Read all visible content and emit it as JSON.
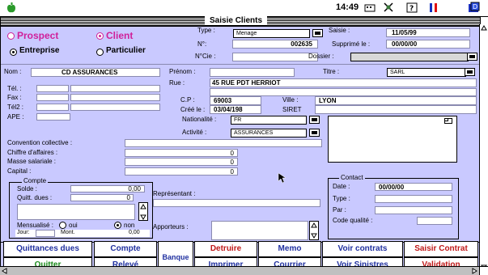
{
  "menubar": {
    "clock": "14:49"
  },
  "window": {
    "title": "Saisie Clients"
  },
  "type_radio": {
    "prospect": "Prospect",
    "client": "Client",
    "selected": "Client"
  },
  "nature_radio": {
    "entreprise": "Entreprise",
    "particulier": "Particulier",
    "selected": "Entreprise"
  },
  "header": {
    "type_label": "Type :",
    "type_value": "Menage",
    "no_label": "N°:",
    "no_value": "002635",
    "ncie_label": "N°Cie :",
    "ncie_value": "",
    "saisie_label": "Saisie :",
    "saisie_value": "11/05/99",
    "supprime_label": "Supprimé le :",
    "supprime_value": "00/00/00",
    "dossier_label": "Dossier :",
    "dossier_value": ""
  },
  "identity": {
    "nom_label": "Nom :",
    "nom_value": "CD ASSURANCES",
    "prenom_label": "Prénom :",
    "prenom_value": "",
    "titre_label": "Titre :",
    "titre_value": "SARL",
    "rue_label": "Rue :",
    "rue_value": "45 RUE PDT HERRIOT",
    "cp_label": "C.P :",
    "cp_value": "69003",
    "ville_label": "Ville :",
    "ville_value": "LYON",
    "cree_label": "Créé le :",
    "cree_value": "03/04/198",
    "siret_label": "SIRET",
    "tel_label": "Tél. :",
    "fax_label": "Fax :",
    "tel2_label": "Tél2 :",
    "ape_label": "APE :",
    "nationalite_label": "Nationalité :",
    "nationalite_value": "FR",
    "activite_label": "Activité :",
    "activite_value": "ASSURANCES"
  },
  "finance": {
    "convention_label": "Convention collective :",
    "ca_label": "Chiffre d'affaires :",
    "ca_value": "0",
    "masse_label": "Masse salariale :",
    "masse_value": "0",
    "capital_label": "Capital :",
    "capital_value": "0"
  },
  "compte": {
    "group_label": "Compte",
    "solde_label": "Solde :",
    "solde_value": "0,00",
    "quitt_label": "Quitt. dues :",
    "quitt_value": "0",
    "mensualise_label": "Mensualisé :",
    "oui_label": "oui",
    "non_label": "non",
    "mensualise_selected": "non",
    "jour_label": "Jour:",
    "mont_label": "Mont.",
    "mont_value": "0,00"
  },
  "representant_label": "Représentant :",
  "apporteurs_label": "Apporteurs :",
  "contact": {
    "group_label": "Contact",
    "date_label": "Date :",
    "date_value": "00/00/00",
    "type_label": "Type :",
    "par_label": "Par :",
    "qualite_label": "Code qualité :"
  },
  "buttons": {
    "quittances_dues": "Quittances dues",
    "compte": "Compte",
    "banque": "Banque",
    "detruire": "Detruire",
    "memo": "Memo",
    "voir_contrats": "Voir contrats",
    "saisir_contrat": "Saisir Contrat",
    "quitter": "Quitter",
    "releve": "Relevé",
    "imprimer": "Imprimer",
    "courrier": "Courrier",
    "voir_sinistres": "Voir Sinistres",
    "validation": "Validation"
  },
  "colors": {
    "form_bg": "#c9c9ff",
    "pink": "#d0209a",
    "blue_btn": "#2030a0",
    "red_btn": "#c01818",
    "green_btn": "#1a8a1a"
  }
}
